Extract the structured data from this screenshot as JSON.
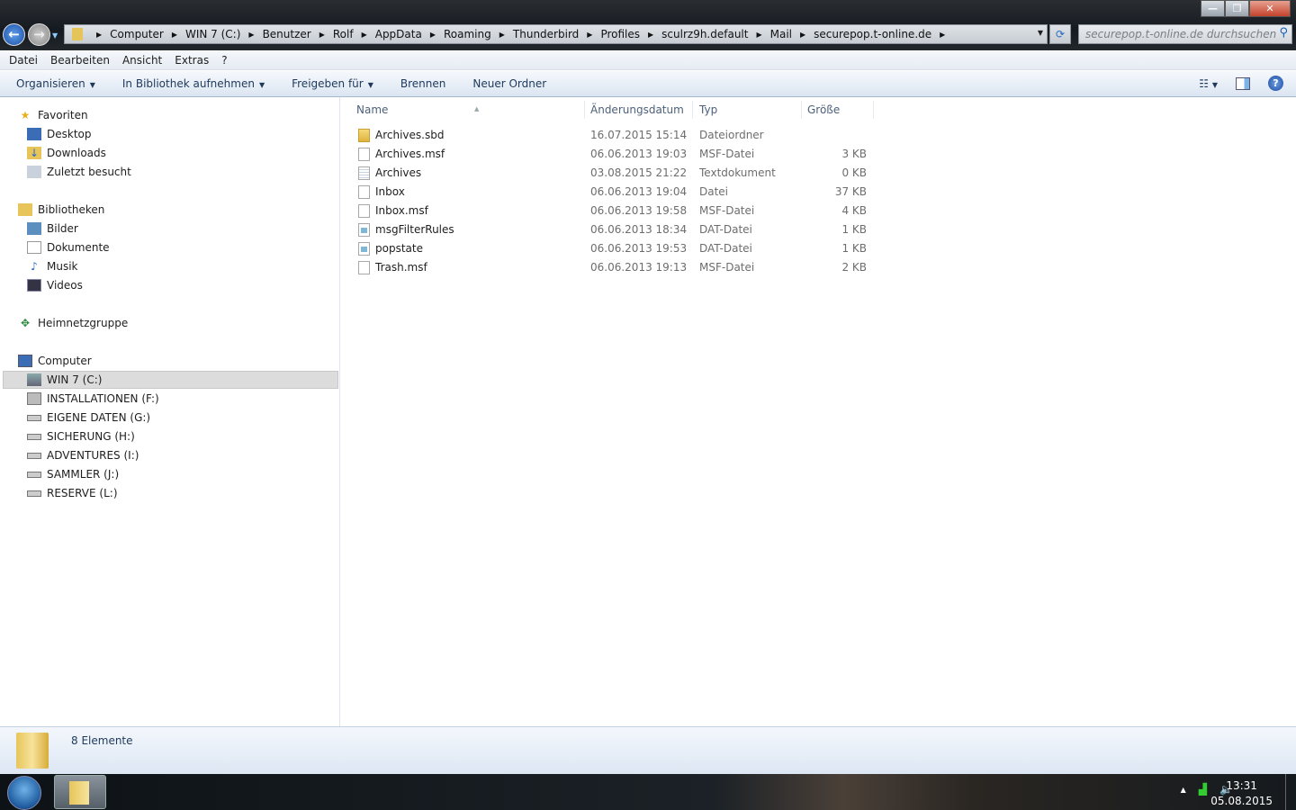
{
  "window": {
    "minimize_icon": "minimize-icon",
    "restore_icon": "restore-icon",
    "close_icon": "close-icon"
  },
  "address": {
    "crumbs": [
      "Computer",
      "WIN 7 (C:)",
      "Benutzer",
      "Rolf",
      "AppData",
      "Roaming",
      "Thunderbird",
      "Profiles",
      "sculrz9h.default",
      "Mail",
      "securepop.t-online.de"
    ]
  },
  "search": {
    "placeholder": "securepop.t-online.de durchsuchen"
  },
  "menu": [
    "Datei",
    "Bearbeiten",
    "Ansicht",
    "Extras",
    "?"
  ],
  "toolbar": {
    "organize": "Organisieren",
    "library": "In Bibliothek aufnehmen",
    "share": "Freigeben für",
    "burn": "Brennen",
    "new_folder": "Neuer Ordner"
  },
  "nav": {
    "favorites": {
      "label": "Favoriten",
      "items": [
        "Desktop",
        "Downloads",
        "Zuletzt besucht"
      ]
    },
    "libraries": {
      "label": "Bibliotheken",
      "items": [
        "Bilder",
        "Dokumente",
        "Musik",
        "Videos"
      ]
    },
    "homegroup": "Heimnetzgruppe",
    "computer": {
      "label": "Computer",
      "items": [
        "WIN 7 (C:)",
        "INSTALLATIONEN (F:)",
        "EIGENE DATEN (G:)",
        "SICHERUNG (H:)",
        "ADVENTURES (I:)",
        "SAMMLER (J:)",
        "RESERVE (L:)"
      ],
      "selected": "WIN 7 (C:)"
    }
  },
  "columns": {
    "name": "Name",
    "date": "Änderungsdatum",
    "type": "Typ",
    "size": "Größe"
  },
  "files": [
    {
      "name": "Archives.sbd",
      "date": "16.07.2015 15:14",
      "type": "Dateiordner",
      "size": "",
      "icon": "folder"
    },
    {
      "name": "Archives.msf",
      "date": "06.06.2013 19:03",
      "type": "MSF-Datei",
      "size": "3 KB",
      "icon": "file"
    },
    {
      "name": "Archives",
      "date": "03.08.2015 21:22",
      "type": "Textdokument",
      "size": "0 KB",
      "icon": "txt"
    },
    {
      "name": "Inbox",
      "date": "06.06.2013 19:04",
      "type": "Datei",
      "size": "37 KB",
      "icon": "file"
    },
    {
      "name": "Inbox.msf",
      "date": "06.06.2013 19:58",
      "type": "MSF-Datei",
      "size": "4 KB",
      "icon": "file"
    },
    {
      "name": "msgFilterRules",
      "date": "06.06.2013 18:34",
      "type": "DAT-Datei",
      "size": "1 KB",
      "icon": "dat"
    },
    {
      "name": "popstate",
      "date": "06.06.2013 19:53",
      "type": "DAT-Datei",
      "size": "1 KB",
      "icon": "dat"
    },
    {
      "name": "Trash.msf",
      "date": "06.06.2013 19:13",
      "type": "MSF-Datei",
      "size": "2 KB",
      "icon": "file"
    }
  ],
  "status": {
    "count": "8 Elemente"
  },
  "taskbar": {
    "time": "13:31",
    "date": "05.08.2015"
  }
}
